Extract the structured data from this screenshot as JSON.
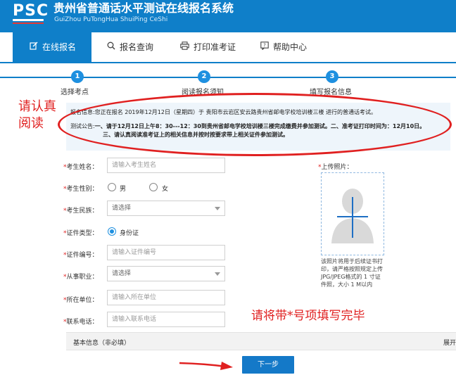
{
  "header": {
    "logo": "PSC",
    "title": "贵州省普通话水平测试在线报名系统",
    "subtitle": "GuiZhou PuTongHua ShuiPing CeShi"
  },
  "nav": {
    "items": [
      {
        "label": "在线报名",
        "icon": "edit-icon",
        "active": true
      },
      {
        "label": "报名查询",
        "icon": "search-icon",
        "active": false
      },
      {
        "label": "打印准考证",
        "icon": "printer-icon",
        "active": false
      },
      {
        "label": "帮助中心",
        "icon": "help-icon",
        "active": false
      }
    ]
  },
  "steps": [
    {
      "num": "1",
      "label": "选择考点"
    },
    {
      "num": "2",
      "label": "阅读报名须知"
    },
    {
      "num": "3",
      "label": "填写报名信息"
    }
  ],
  "notice": {
    "info_prefix": "报名信息:",
    "info_text": "您正在报名 2019年12月12日（星期四）于 贵阳市云岩区安云路贵州省邮电学校培训楼三楼 进行的普通话考试。",
    "test_prefix": "测试公告:",
    "test_line1": "一、请于12月12日上午8：30---12：30到贵州省邮电学校培训楼三楼完成缴费并参加测试。二、准考证打印时间为：12月10日。",
    "test_line2": "三、请认真阅读准考证上的相关信息并按时按要求带上相关证件参加测试。"
  },
  "annotations": {
    "read_carefully": "请认真阅读",
    "fill_required": "请将带*号项填写完毕"
  },
  "form": {
    "star": "*",
    "name_label": "考生姓名：",
    "name_placeholder": "请输入考生姓名",
    "gender_label": "考生性别：",
    "gender_male": "男",
    "gender_female": "女",
    "ethnicity_label": "考生民族：",
    "ethnicity_value": "请选择",
    "id_type_label": "证件类型：",
    "id_type_value": "身份证",
    "id_number_label": "证件编号：",
    "id_number_placeholder": "请输入证件编号",
    "occupation_label": "从事职业：",
    "occupation_value": "请选择",
    "unit_label": "所在单位：",
    "unit_placeholder": "请输入所在单位",
    "phone_label": "联系电话：",
    "phone_placeholder": "请输入联系电话"
  },
  "photo": {
    "label": "上传照片：",
    "note": "该照片将用于后续证书打印，请严格按照规定上传JPG/JPEG格式的 1 寸证件照，大小 1 M以内"
  },
  "bottom": {
    "basic_info": "基本信息（非必填）",
    "expand": "展开",
    "next": "下一步"
  },
  "colors": {
    "brand_blue": "#0f7fc9",
    "annotation_red": "#e02020"
  }
}
